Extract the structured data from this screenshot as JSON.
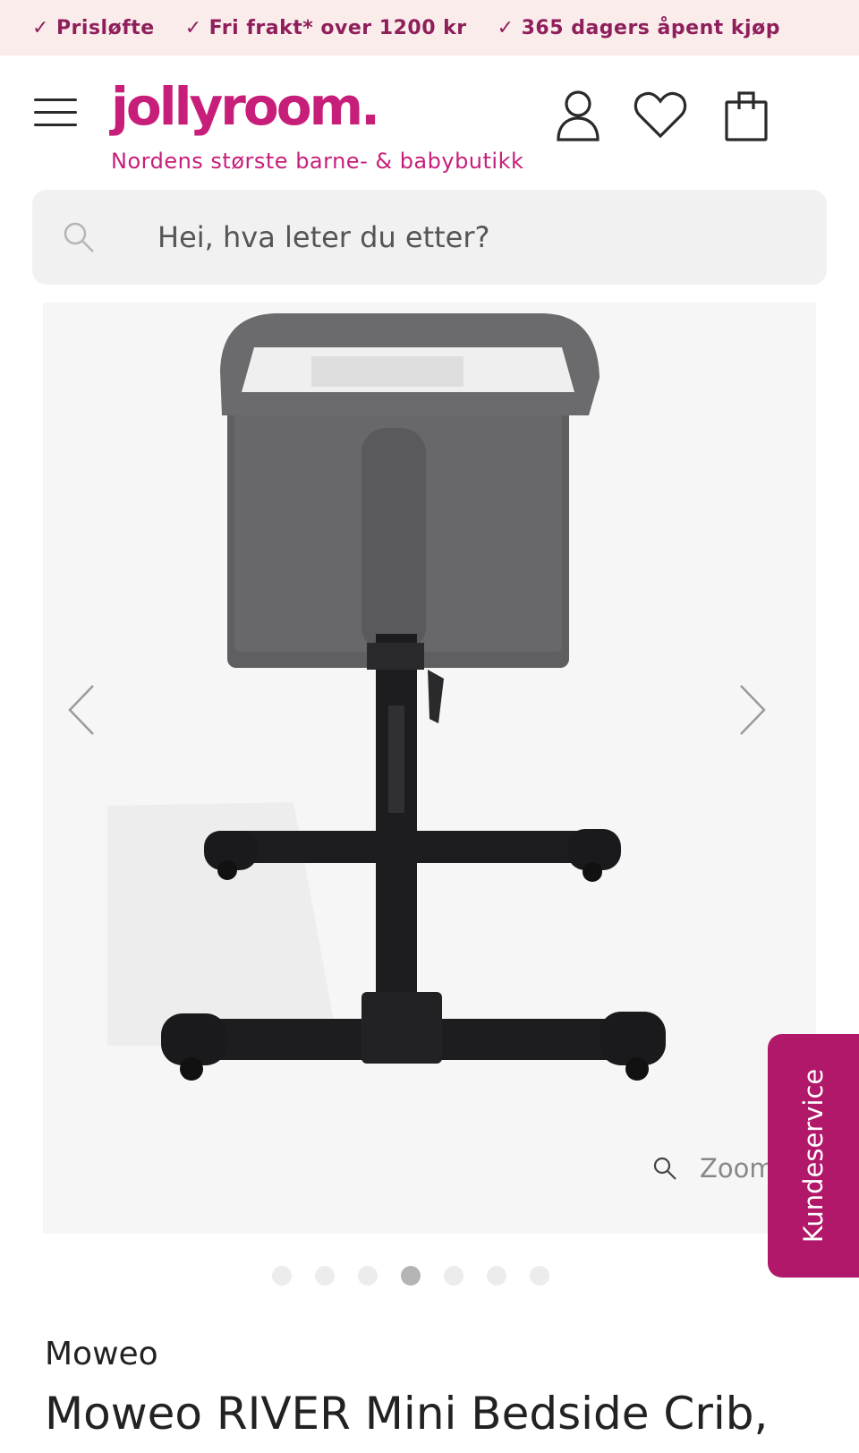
{
  "topbar": {
    "usps": [
      {
        "icon": "check-icon",
        "text": "Prisløfte"
      },
      {
        "icon": "check-icon",
        "text": "Fri frakt* over 1200 kr"
      },
      {
        "icon": "check-icon",
        "text": "365 dagers åpent kjøp"
      }
    ]
  },
  "header": {
    "logo": "jollyroom.",
    "tagline": "Nordens største barne- & babybutikk",
    "icons": [
      "hamburger-menu-icon",
      "account-icon",
      "heart-icon",
      "shopping-bag-icon"
    ]
  },
  "search": {
    "placeholder": "Hei, hva leter du etter?"
  },
  "gallery": {
    "zoom_label": "Zoom",
    "slide_count": 7,
    "active_slide": 4
  },
  "customer_service": {
    "label": "Kundeservice"
  },
  "product": {
    "brand": "Moweo",
    "title": "Moweo RIVER Mini Bedside Crib,"
  },
  "colors": {
    "brand_pink": "#c71e7a",
    "usp_text": "#8e1f5b",
    "topbar_bg": "#fbecec",
    "service_tab": "#b2186a"
  }
}
